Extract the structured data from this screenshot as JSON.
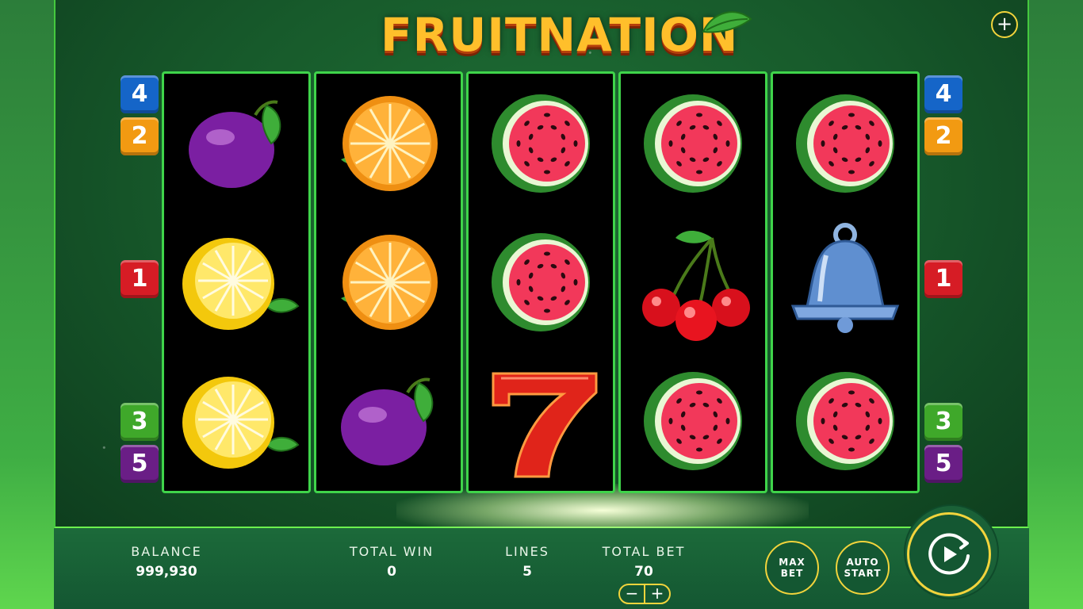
{
  "game": {
    "title": "FRUITNATION"
  },
  "menu_plus": "+",
  "paylines_left": [
    "4",
    "2",
    "1",
    "3",
    "5"
  ],
  "paylines_right": [
    "4",
    "2",
    "1",
    "3",
    "5"
  ],
  "payline_colors": {
    "1": "#d61c25",
    "2": "#f29a12",
    "3": "#3fa82a",
    "4": "#1565c8",
    "5": "#6a1e86"
  },
  "reels": [
    [
      "plum",
      "lemon",
      "lemon"
    ],
    [
      "orange",
      "orange",
      "plum"
    ],
    [
      "watermelon",
      "watermelon",
      "seven"
    ],
    [
      "watermelon",
      "cherries",
      "watermelon"
    ],
    [
      "watermelon",
      "bell",
      "watermelon"
    ]
  ],
  "footer": {
    "balance_label": "BALANCE",
    "balance_value": "999,930",
    "total_win_label": "TOTAL WIN",
    "total_win_value": "0",
    "lines_label": "LINES",
    "lines_value": "5",
    "total_bet_label": "TOTAL BET",
    "total_bet_value": "70",
    "bet_minus": "−",
    "bet_plus": "+",
    "max_bet_label": "MAX BET",
    "auto_start_label": "AUTO START"
  }
}
